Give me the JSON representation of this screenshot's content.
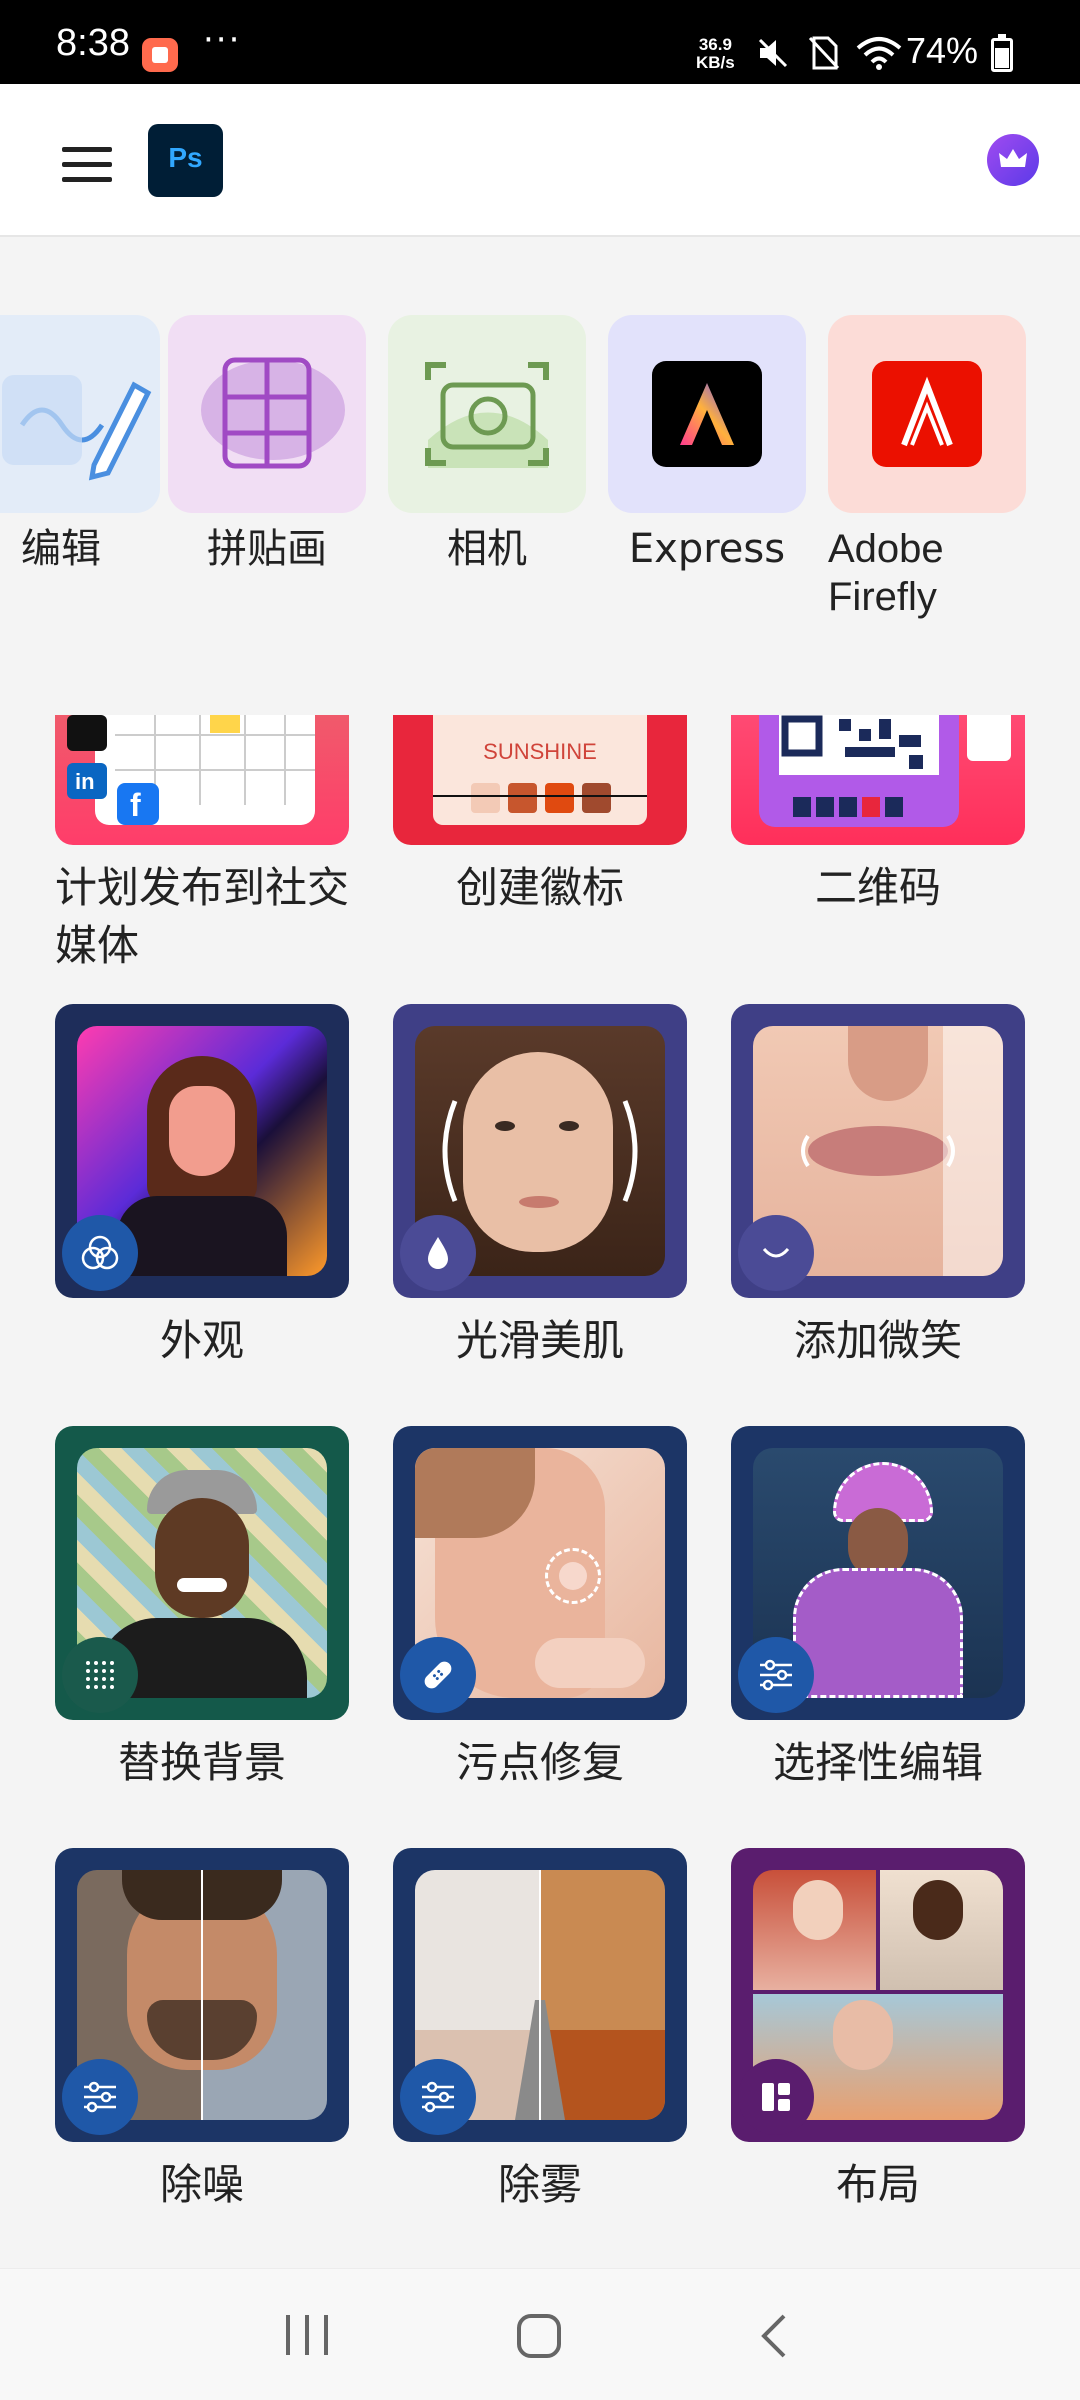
{
  "status_bar": {
    "time": "8:38",
    "more": "···",
    "net_speed_value": "36.9",
    "net_speed_unit": "KB/s",
    "battery": "74%"
  },
  "header": {
    "logo_text": "Ps",
    "brand_color": "#31a8ff"
  },
  "tools": [
    {
      "label": "编辑",
      "bg": "#e3ecf8"
    },
    {
      "label": "拼贴画",
      "bg": "#f1def4"
    },
    {
      "label": "相机",
      "bg": "#e8f2e2"
    },
    {
      "label": "Express",
      "bg": "#e2e2fb"
    },
    {
      "label": "Adobe Firefly",
      "bg": "#fcdcd7"
    }
  ],
  "cards_row1": [
    {
      "label": "计划发布到社交媒体"
    },
    {
      "label": "创建徽标",
      "thumb_text": "SUNSHINE"
    },
    {
      "label": "二维码"
    }
  ],
  "cards": [
    {
      "label": "外观",
      "icon": "overlap-circles-icon"
    },
    {
      "label": "光滑美肌",
      "icon": "droplet-icon"
    },
    {
      "label": "添加微笑",
      "icon": "smile-icon"
    },
    {
      "label": "替换背景",
      "icon": "pattern-icon"
    },
    {
      "label": "污点修复",
      "icon": "bandage-icon"
    },
    {
      "label": "选择性编辑",
      "icon": "sliders-icon"
    },
    {
      "label": "除噪",
      "icon": "sliders-icon"
    },
    {
      "label": "除雾",
      "icon": "sliders-icon"
    },
    {
      "label": "布局",
      "icon": "layout-icon"
    }
  ]
}
